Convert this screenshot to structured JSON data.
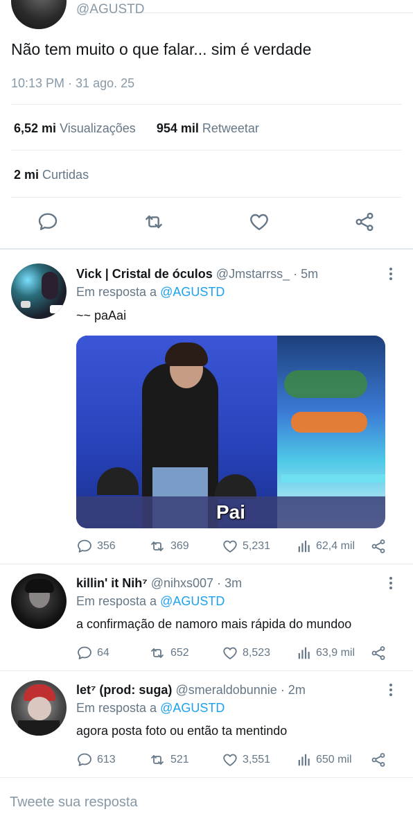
{
  "main_tweet": {
    "handle": "@AGUSTD",
    "text": "Não tem muito o que falar... sim é verdade",
    "timestamp": "10:13 PM · 31 ago. 25",
    "views_count": "6,52 mi",
    "views_label": "Visualizações",
    "retweets_count": "954 mil",
    "retweets_label": "Retweetar",
    "likes_count": "2 mi",
    "likes_label": "Curtidas",
    "actions": [
      "reply-icon",
      "retweet-icon",
      "like-icon",
      "share-icon"
    ]
  },
  "replies": [
    {
      "name": "Vick | Cristal de óculos",
      "handle": "@Jmstarrss_",
      "time": "· 5m",
      "reply_prefix": "Em resposta a",
      "reply_to": "@AGUSTD",
      "text": "~~ paAai",
      "media_caption": "Pai",
      "replies": "356",
      "retweets": "369",
      "likes": "5,231",
      "views": "62,4 mil"
    },
    {
      "name": "killin' it Nih⁷",
      "handle": "@nihxs007",
      "time": "· 3m",
      "reply_prefix": "Em resposta a",
      "reply_to": "@AGUSTD",
      "text": "a confirmação de namoro mais rápida do mundoo",
      "replies": "64",
      "retweets": "652",
      "likes": "8,523",
      "views": "63,9 mil"
    },
    {
      "name": "let⁷ (prod: suga)",
      "handle": "@smeraldobunnie",
      "time": "· 2m",
      "reply_prefix": "Em resposta a",
      "reply_to": "@AGUSTD",
      "text": "agora posta foto ou então ta mentindo",
      "replies": "613",
      "retweets": "521",
      "likes": "3,551",
      "views": "650 mil"
    }
  ],
  "compose": {
    "placeholder": "Tweete sua resposta"
  },
  "colors": {
    "link": "#1da1f2",
    "muted": "#657786",
    "divider": "#e6ecf0"
  }
}
